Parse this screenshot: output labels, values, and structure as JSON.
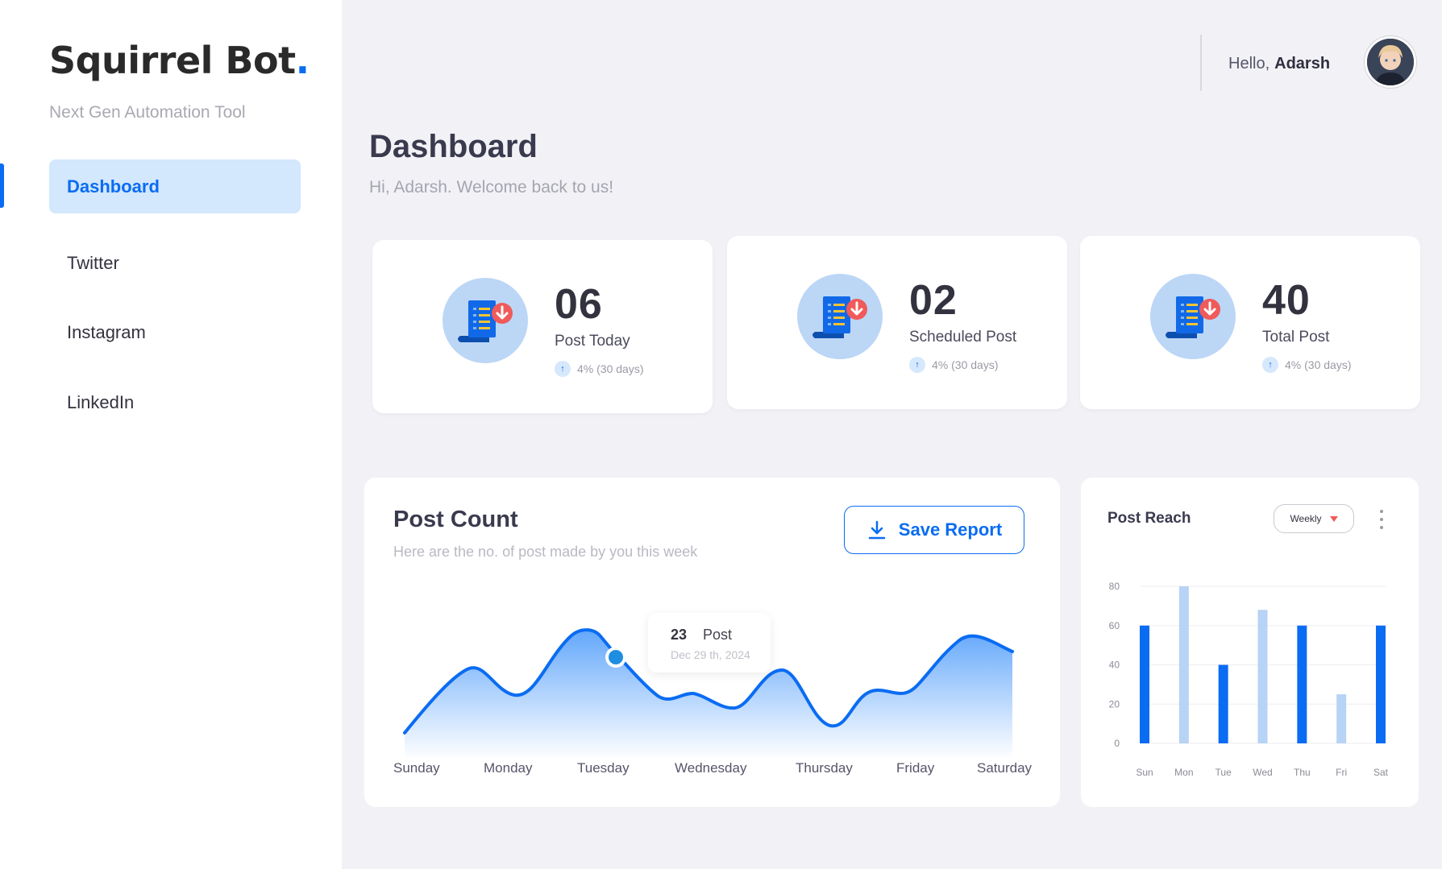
{
  "sidebar": {
    "brand": "Squirrel Bot",
    "brand_dot": ".",
    "tagline": "Next Gen Automation Tool",
    "items": [
      {
        "label": "Dashboard",
        "active": true
      },
      {
        "label": "Twitter",
        "active": false
      },
      {
        "label": "Instagram",
        "active": false
      },
      {
        "label": "LinkedIn",
        "active": false
      }
    ]
  },
  "header": {
    "greeting": "Hello,",
    "user_name": "Adarsh"
  },
  "page": {
    "title": "Dashboard",
    "subtitle": "Hi, Adarsh. Welcome back  to  us!"
  },
  "stats": [
    {
      "value": "06",
      "label": "Post Today",
      "trend": "4% (30 days)"
    },
    {
      "value": "02",
      "label": "Scheduled Post",
      "trend": "4% (30 days)"
    },
    {
      "value": "40",
      "label": "Total Post",
      "trend": "4% (30 days)"
    }
  ],
  "post_count": {
    "title": "Post Count",
    "subtitle": "Here are the no. of post made by you this week",
    "save_label": "Save Report",
    "tooltip": {
      "value": "23",
      "label": "Post",
      "date": "Dec 29 th, 2024"
    },
    "days": [
      "Sunday",
      "Monday",
      "Tuesday",
      "Wednesday",
      "Thursday",
      "Friday",
      "Saturday"
    ]
  },
  "post_reach": {
    "title": "Post Reach",
    "period": "Weekly"
  },
  "colors": {
    "accent": "#0a6cf2",
    "accent_light": "#d3e7fd",
    "bar_light": "#b7d3f5",
    "badge_red": "#f05a5a",
    "background": "#f2f2f6"
  },
  "chart_data": [
    {
      "type": "area",
      "title": "Post Count",
      "categories": [
        "Sunday",
        "Monday",
        "Tuesday",
        "Wednesday",
        "Thursday",
        "Friday",
        "Saturday"
      ],
      "highlight": {
        "category": "Tuesday",
        "value": 23,
        "label": "Post",
        "date": "Dec 29 th, 2024"
      }
    },
    {
      "type": "bar",
      "title": "Post Reach",
      "categories": [
        "Sun",
        "Mon",
        "Tue",
        "Wed",
        "Thu",
        "Fri",
        "Sat"
      ],
      "values": [
        60,
        80,
        40,
        68,
        60,
        25,
        60
      ],
      "highlighted": [
        true,
        false,
        true,
        false,
        true,
        false,
        true
      ],
      "ylim": [
        0,
        80
      ],
      "yticks": [
        0,
        20,
        40,
        60,
        80
      ],
      "grid": true
    }
  ]
}
